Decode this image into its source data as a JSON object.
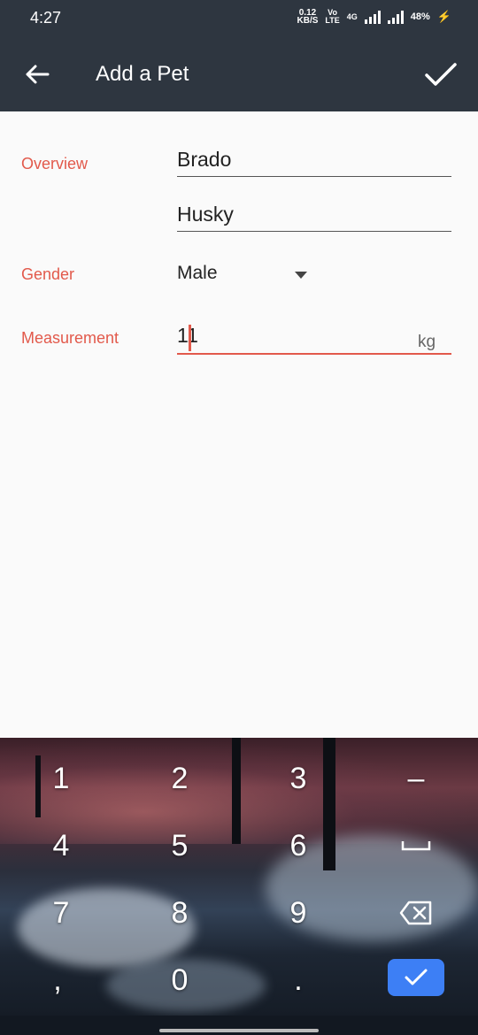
{
  "status_bar": {
    "time": "4:27",
    "net_speed_value": "0.12",
    "net_speed_unit": "KB/S",
    "volte_top": "Vo",
    "volte_bottom": "LTE",
    "network_type": "4G",
    "battery": "48%"
  },
  "app_bar": {
    "title": "Add a Pet",
    "back_icon": "arrow-left-icon",
    "save_icon": "check-icon"
  },
  "form": {
    "overview_label": "Overview",
    "name_value": "Brado",
    "breed_value": "Husky",
    "gender_label": "Gender",
    "gender_value": "Male",
    "measurement_label": "Measurement",
    "measurement_value": "11",
    "measurement_unit": "kg"
  },
  "keyboard": {
    "keys": [
      {
        "label": "1"
      },
      {
        "label": "2"
      },
      {
        "label": "3"
      },
      {
        "label": "–"
      },
      {
        "label": "4"
      },
      {
        "label": "5"
      },
      {
        "label": "6"
      },
      {
        "label": "␣"
      },
      {
        "label": "7"
      },
      {
        "label": "8"
      },
      {
        "label": "9"
      },
      {
        "label": "backspace"
      },
      {
        "label": ","
      },
      {
        "label": "0"
      },
      {
        "label": "."
      },
      {
        "label": "done"
      }
    ],
    "done_color": "#3d7ff5"
  },
  "colors": {
    "app_bar": "#2e3640",
    "accent": "#e2594b"
  }
}
